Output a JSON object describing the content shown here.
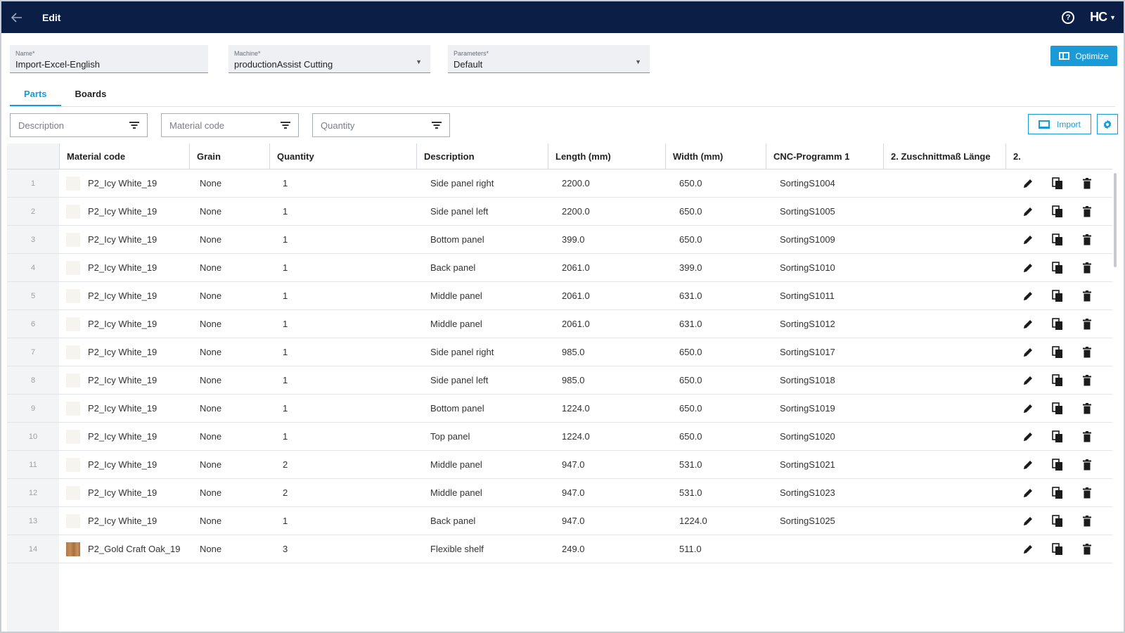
{
  "header": {
    "title": "Edit",
    "logo": "HC"
  },
  "fields": {
    "name": {
      "label": "Name*",
      "value": "Import-Excel-English"
    },
    "machine": {
      "label": "Machine*",
      "value": "productionAssist Cutting"
    },
    "parameters": {
      "label": "Parameters*",
      "value": "Default"
    }
  },
  "optimize_label": "Optimize",
  "tabs": [
    {
      "label": "Parts",
      "active": true
    },
    {
      "label": "Boards",
      "active": false
    }
  ],
  "filters": [
    {
      "placeholder": "Description"
    },
    {
      "placeholder": "Material code"
    },
    {
      "placeholder": "Quantity"
    }
  ],
  "import_label": "Import",
  "columns": [
    "Material code",
    "Grain",
    "Quantity",
    "Description",
    "Length (mm)",
    "Width (mm)",
    "CNC-Programm 1",
    "2. Zuschnittmaß Länge",
    "2."
  ],
  "rows": [
    {
      "n": "1",
      "material": "P2_Icy White_19",
      "grain": "None",
      "qty": "1",
      "desc": "Side panel right",
      "length": "2200.0",
      "width": "650.0",
      "cnc": "SortingS1004",
      "swatch": "white"
    },
    {
      "n": "2",
      "material": "P2_Icy White_19",
      "grain": "None",
      "qty": "1",
      "desc": "Side panel left",
      "length": "2200.0",
      "width": "650.0",
      "cnc": "SortingS1005",
      "swatch": "white"
    },
    {
      "n": "3",
      "material": "P2_Icy White_19",
      "grain": "None",
      "qty": "1",
      "desc": "Bottom panel",
      "length": "399.0",
      "width": "650.0",
      "cnc": "SortingS1009",
      "swatch": "white"
    },
    {
      "n": "4",
      "material": "P2_Icy White_19",
      "grain": "None",
      "qty": "1",
      "desc": "Back panel",
      "length": "2061.0",
      "width": "399.0",
      "cnc": "SortingS1010",
      "swatch": "white"
    },
    {
      "n": "5",
      "material": "P2_Icy White_19",
      "grain": "None",
      "qty": "1",
      "desc": "Middle panel",
      "length": "2061.0",
      "width": "631.0",
      "cnc": "SortingS1011",
      "swatch": "white"
    },
    {
      "n": "6",
      "material": "P2_Icy White_19",
      "grain": "None",
      "qty": "1",
      "desc": "Middle panel",
      "length": "2061.0",
      "width": "631.0",
      "cnc": "SortingS1012",
      "swatch": "white"
    },
    {
      "n": "7",
      "material": "P2_Icy White_19",
      "grain": "None",
      "qty": "1",
      "desc": "Side panel right",
      "length": "985.0",
      "width": "650.0",
      "cnc": "SortingS1017",
      "swatch": "white"
    },
    {
      "n": "8",
      "material": "P2_Icy White_19",
      "grain": "None",
      "qty": "1",
      "desc": "Side panel left",
      "length": "985.0",
      "width": "650.0",
      "cnc": "SortingS1018",
      "swatch": "white"
    },
    {
      "n": "9",
      "material": "P2_Icy White_19",
      "grain": "None",
      "qty": "1",
      "desc": "Bottom panel",
      "length": "1224.0",
      "width": "650.0",
      "cnc": "SortingS1019",
      "swatch": "white"
    },
    {
      "n": "10",
      "material": "P2_Icy White_19",
      "grain": "None",
      "qty": "1",
      "desc": "Top panel",
      "length": "1224.0",
      "width": "650.0",
      "cnc": "SortingS1020",
      "swatch": "white"
    },
    {
      "n": "11",
      "material": "P2_Icy White_19",
      "grain": "None",
      "qty": "2",
      "desc": "Middle panel",
      "length": "947.0",
      "width": "531.0",
      "cnc": "SortingS1021",
      "swatch": "white"
    },
    {
      "n": "12",
      "material": "P2_Icy White_19",
      "grain": "None",
      "qty": "2",
      "desc": "Middle panel",
      "length": "947.0",
      "width": "531.0",
      "cnc": "SortingS1023",
      "swatch": "white"
    },
    {
      "n": "13",
      "material": "P2_Icy White_19",
      "grain": "None",
      "qty": "1",
      "desc": "Back panel",
      "length": "947.0",
      "width": "1224.0",
      "cnc": "SortingS1025",
      "swatch": "white"
    },
    {
      "n": "14",
      "material": "P2_Gold Craft Oak_19",
      "grain": "None",
      "qty": "3",
      "desc": "Flexible shelf",
      "length": "249.0",
      "width": "511.0",
      "cnc": "",
      "swatch": "oak"
    }
  ],
  "icons": {
    "back": "arrow-left-icon",
    "help": "help-circle-icon",
    "edit": "pencil-icon",
    "copy": "copy-icon",
    "delete": "trash-icon",
    "settings": "gear-icon",
    "filter": "filter-icon"
  },
  "colors": {
    "topbar": "#0b1f46",
    "accent": "#1a9ad6"
  }
}
